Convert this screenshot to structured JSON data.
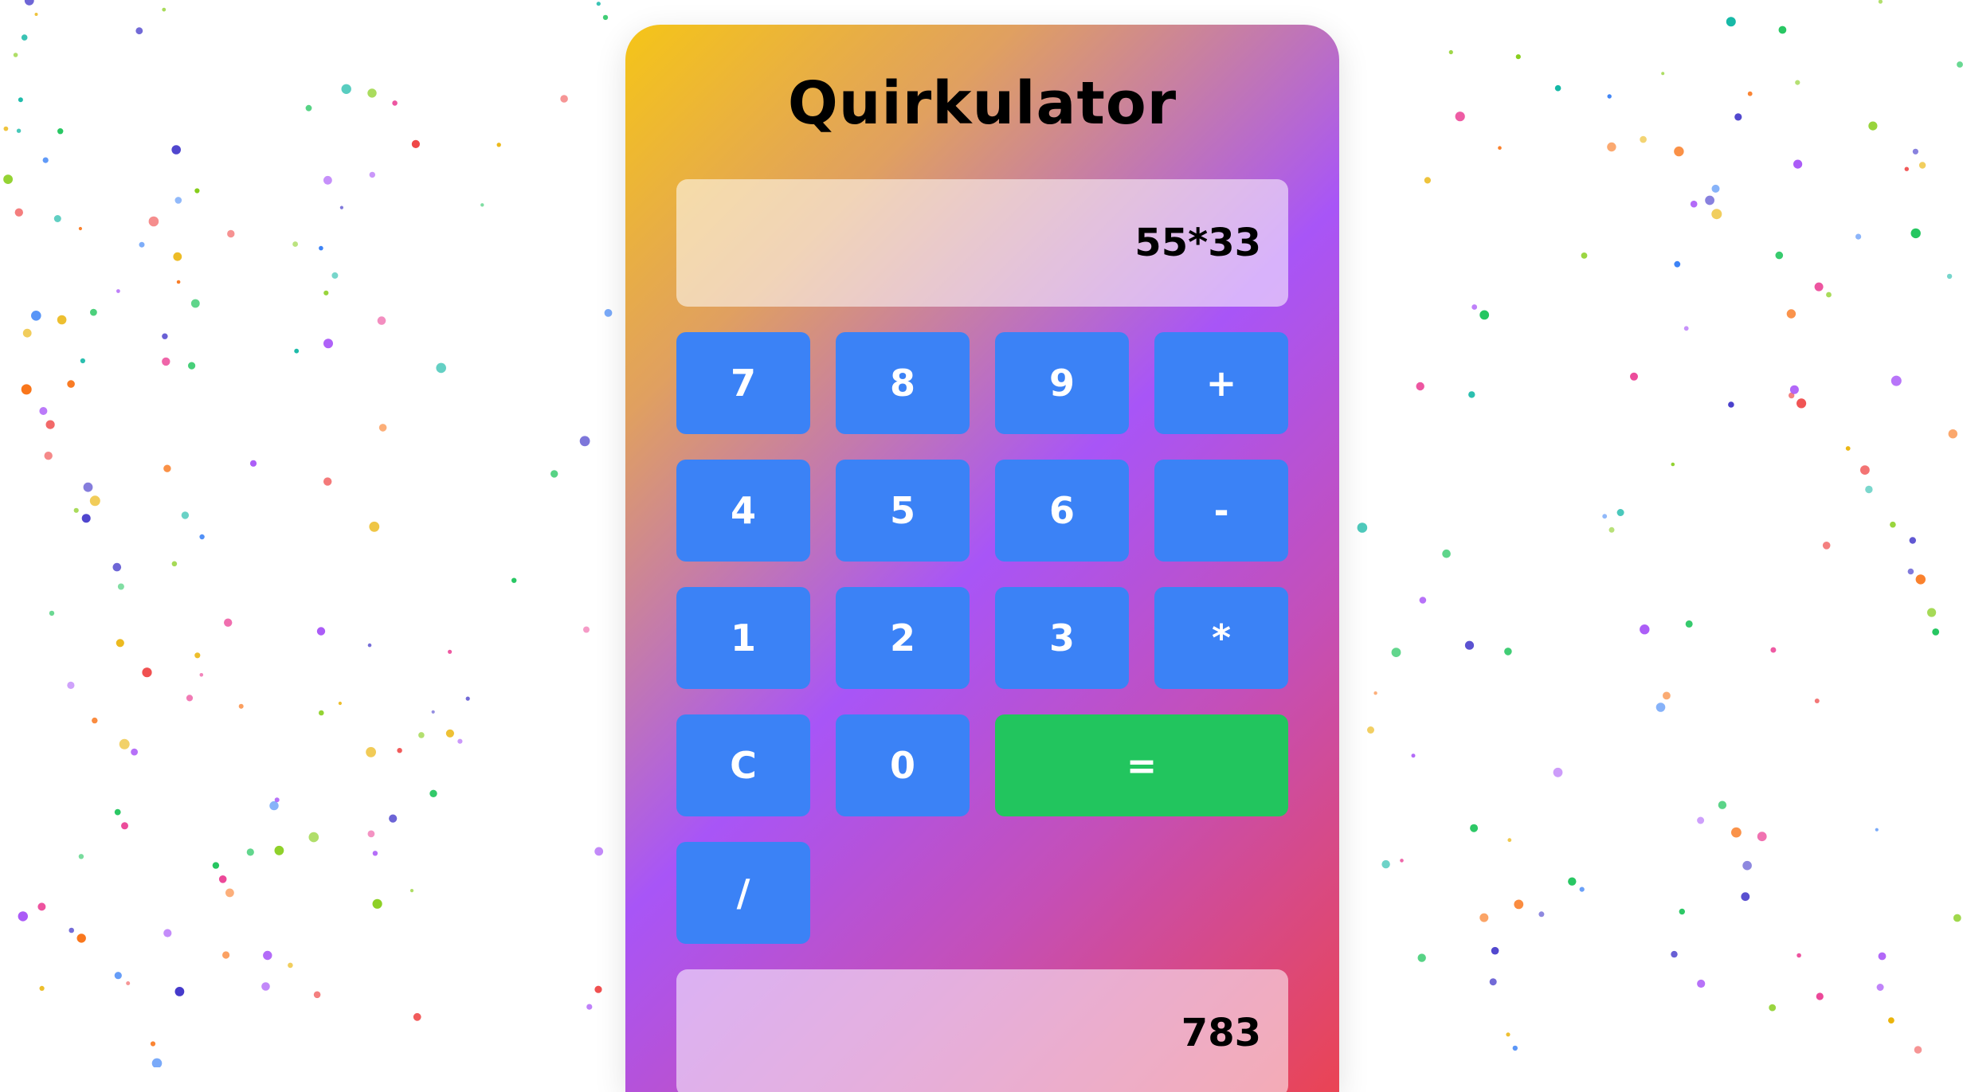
{
  "app": {
    "title": "Quirkulator"
  },
  "display": {
    "expression": "55*33",
    "result": "783"
  },
  "keys": [
    {
      "label": "7",
      "name": "key-7"
    },
    {
      "label": "8",
      "name": "key-8"
    },
    {
      "label": "9",
      "name": "key-9"
    },
    {
      "label": "+",
      "name": "key-plus"
    },
    {
      "label": "4",
      "name": "key-4"
    },
    {
      "label": "5",
      "name": "key-5"
    },
    {
      "label": "6",
      "name": "key-6"
    },
    {
      "label": "-",
      "name": "key-minus"
    },
    {
      "label": "1",
      "name": "key-1"
    },
    {
      "label": "2",
      "name": "key-2"
    },
    {
      "label": "3",
      "name": "key-3"
    },
    {
      "label": "*",
      "name": "key-multiply"
    },
    {
      "label": "C",
      "name": "key-clear"
    },
    {
      "label": "0",
      "name": "key-0"
    },
    {
      "label": "=",
      "name": "key-equals"
    },
    {
      "label": "/",
      "name": "key-divide"
    }
  ],
  "colors": {
    "key": "#3b82f6",
    "equals_key": "#22c55e",
    "gradient": [
      "#f5c518",
      "#a855f7",
      "#ea4454"
    ],
    "confetti": [
      "#ef4444",
      "#3b82f6",
      "#22c55e",
      "#a855f7",
      "#eab308",
      "#14b8a6",
      "#f97316",
      "#4338ca",
      "#84cc16",
      "#ec4899"
    ]
  }
}
